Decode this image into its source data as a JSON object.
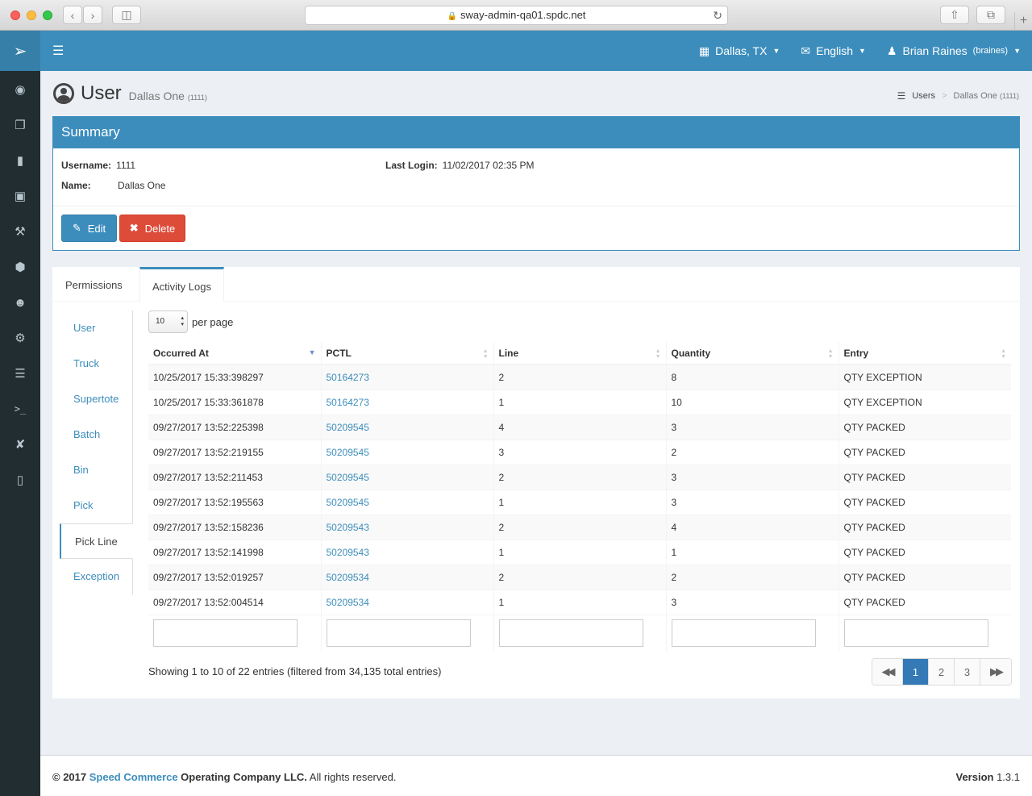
{
  "browser": {
    "url": "sway-admin-qa01.spdc.net",
    "plus": "+"
  },
  "topnav": {
    "location": "Dallas, TX",
    "language": "English",
    "user_name": "Brian Raines",
    "user_handle": "(braines)"
  },
  "sidebar": {
    "icons": [
      "dashboard-icon",
      "copy-icon",
      "file-icon",
      "medkit-icon",
      "wrench-icon",
      "cube-icon",
      "user-circle-icon",
      "cogs-icon",
      "list-icon",
      "terminal-icon",
      "wrench-alt-icon",
      "mobile-icon"
    ]
  },
  "header": {
    "title": "User",
    "subtitle": "Dallas One",
    "subtitle_id": "(1111)"
  },
  "breadcrumb": {
    "root": "Users",
    "sep": ">",
    "current": "Dallas One",
    "current_id": "(1111)"
  },
  "summary": {
    "title": "Summary",
    "username_label": "Username:",
    "username": "1111",
    "lastlogin_label": "Last Login:",
    "lastlogin": "11/02/2017 02:35 PM",
    "name_label": "Name:",
    "name": "Dallas One",
    "edit_label": "Edit",
    "delete_label": "Delete"
  },
  "tabs": {
    "permissions": "Permissions",
    "activity": "Activity Logs"
  },
  "vnav": {
    "items": [
      "User",
      "Truck",
      "Supertote",
      "Batch",
      "Bin",
      "Pick",
      "Pick Line",
      "Exception"
    ],
    "active": "Pick Line"
  },
  "table": {
    "per_page_value": "10",
    "per_page_label": "per page",
    "columns": [
      "Occurred At",
      "PCTL",
      "Line",
      "Quantity",
      "Entry"
    ],
    "rows": [
      [
        "10/25/2017 15:33:398297",
        "50164273",
        "2",
        "8",
        "QTY EXCEPTION"
      ],
      [
        "10/25/2017 15:33:361878",
        "50164273",
        "1",
        "10",
        "QTY EXCEPTION"
      ],
      [
        "09/27/2017 13:52:225398",
        "50209545",
        "4",
        "3",
        "QTY PACKED"
      ],
      [
        "09/27/2017 13:52:219155",
        "50209545",
        "3",
        "2",
        "QTY PACKED"
      ],
      [
        "09/27/2017 13:52:211453",
        "50209545",
        "2",
        "3",
        "QTY PACKED"
      ],
      [
        "09/27/2017 13:52:195563",
        "50209545",
        "1",
        "3",
        "QTY PACKED"
      ],
      [
        "09/27/2017 13:52:158236",
        "50209543",
        "2",
        "4",
        "QTY PACKED"
      ],
      [
        "09/27/2017 13:52:141998",
        "50209543",
        "1",
        "1",
        "QTY PACKED"
      ],
      [
        "09/27/2017 13:52:019257",
        "50209534",
        "2",
        "2",
        "QTY PACKED"
      ],
      [
        "09/27/2017 13:52:004514",
        "50209534",
        "1",
        "3",
        "QTY PACKED"
      ]
    ],
    "info": "Showing 1 to 10 of 22 entries (filtered from 34,135 total entries)",
    "pages": [
      "1",
      "2",
      "3"
    ]
  },
  "footer": {
    "prefix": "© 2017 ",
    "brand": "Speed Commerce",
    "company": " Operating Company LLC.",
    "rights": " All rights reserved.",
    "version_label": "Version",
    "version": "1.3.1"
  },
  "colors": {
    "primary": "#3c8dbc",
    "danger": "#dd4b39",
    "sidebar": "#222d32"
  }
}
